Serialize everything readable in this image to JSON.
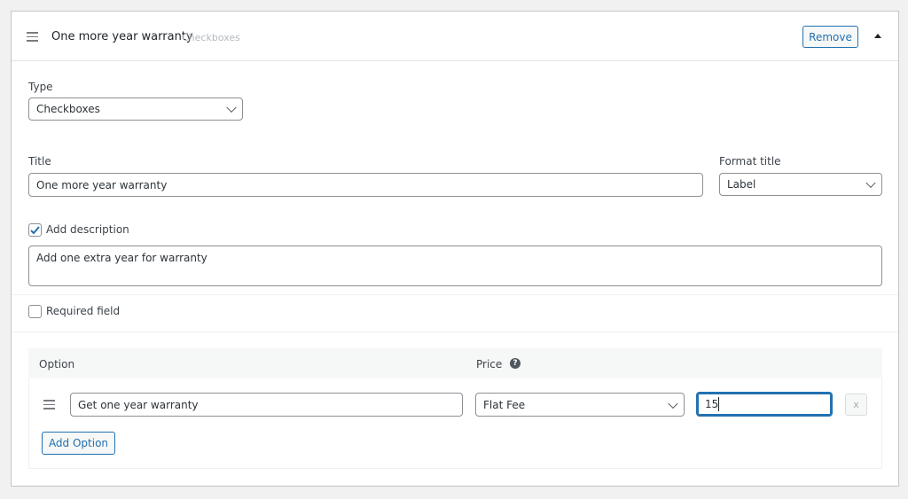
{
  "header": {
    "title": "One more year warranty",
    "type_hint": "Checkboxes",
    "remove_label": "Remove"
  },
  "type": {
    "label": "Type",
    "value": "Checkboxes"
  },
  "title": {
    "label": "Title",
    "value": "One more year warranty"
  },
  "format_title": {
    "label": "Format title",
    "value": "Label"
  },
  "description": {
    "checkbox_label": "Add description",
    "checked": true,
    "value": "Add one extra year for warranty"
  },
  "required": {
    "label": "Required field",
    "checked": false
  },
  "options": {
    "col_option": "Option",
    "col_price": "Price",
    "rows": [
      {
        "option": "Get one year warranty",
        "price_type": "Flat Fee",
        "price": "15",
        "remove": "x"
      }
    ],
    "add_label": "Add Option"
  },
  "colors": {
    "accent": "#2271b1",
    "focus": "#2271b1"
  }
}
